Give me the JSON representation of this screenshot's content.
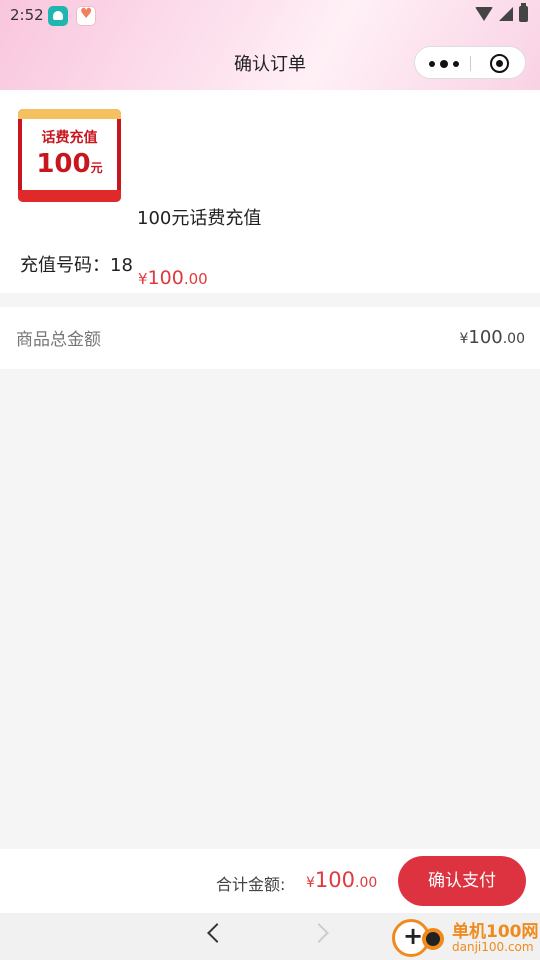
{
  "status_bar": {
    "time": "2:52"
  },
  "nav": {
    "title": "确认订单"
  },
  "product": {
    "name": "100元话费充值",
    "thumb_title": "话费充值",
    "thumb_amount": "100",
    "thumb_unit": "元",
    "price_symbol": "¥",
    "price_int": "100",
    "price_dec": ".00"
  },
  "phone": {
    "label": "充值号码：18"
  },
  "summary": {
    "label": "商品总金额",
    "symbol": "¥",
    "int": "100",
    "dec": ".00"
  },
  "footer": {
    "sum_label": "合计金额:",
    "symbol": "¥",
    "int": "100",
    "dec": ".00",
    "pay_label": "确认支付"
  },
  "watermark": {
    "line1": "单机100网",
    "line2": "danji100.com"
  },
  "colors": {
    "accent": "#dd3340",
    "price": "#e0393e",
    "header_pink": "#f9c6de"
  },
  "icons": [
    "more-icon",
    "target-icon",
    "wifi-icon",
    "signal-icon",
    "battery-icon",
    "back-icon",
    "forward-icon"
  ]
}
